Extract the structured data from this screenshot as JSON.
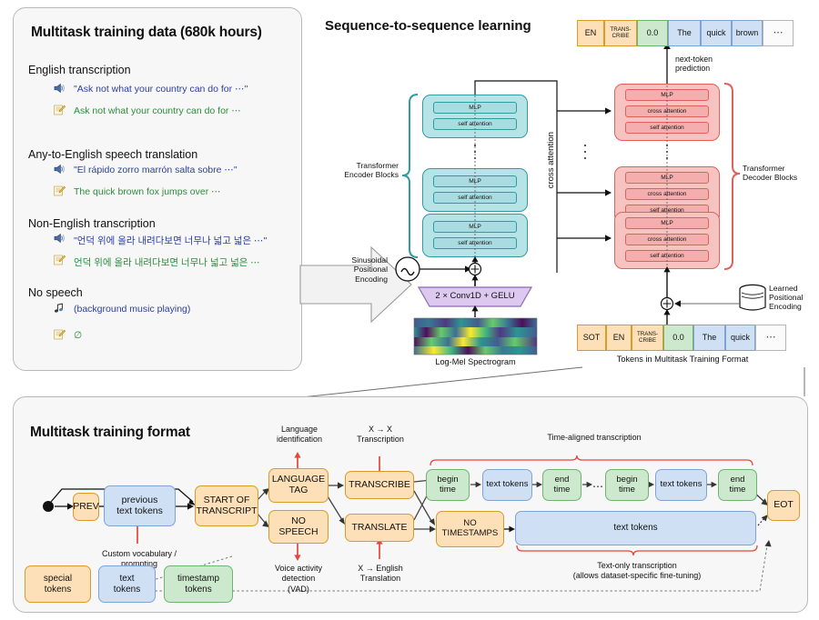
{
  "left_panel": {
    "title": "Multitask training data (680k hours)",
    "sections": [
      {
        "heading": "English transcription",
        "audio_icon": "speaker-icon",
        "audio": "\"Ask not what your country can do for ⋯\"",
        "text_icon": "note-pencil-icon",
        "text": "Ask not what your country can do for ⋯"
      },
      {
        "heading": "Any-to-English speech translation",
        "audio_icon": "speaker-icon",
        "audio": "\"El rápido zorro marrón salta sobre ⋯\"",
        "text_icon": "note-pencil-icon",
        "text": "The quick brown fox jumps over ⋯"
      },
      {
        "heading": "Non-English transcription",
        "audio_icon": "speaker-icon",
        "audio": "\"언덕 위에 올라 내려다보면 너무나 넓고 넓은 ⋯\"",
        "text_icon": "note-pencil-icon",
        "text": "언덕 위에 올라 내려다보면 너무나 넓고 넓은 ⋯"
      },
      {
        "heading": "No speech",
        "audio_icon": "music-note-icon",
        "audio": "(background music playing)",
        "text_icon": "note-pencil-icon",
        "text": "∅"
      }
    ]
  },
  "seq2seq": {
    "title": "Sequence-to-sequence learning",
    "encoder_label": "Transformer\nEncoder Blocks",
    "encoder_label_line1": "Transformer",
    "encoder_label_line2": "Encoder Blocks",
    "decoder_label_line1": "Transformer",
    "decoder_label_line2": "Decoder Blocks",
    "cross_attention_label": "cross attention",
    "sinusoidal_label_line1": "Sinusoidal",
    "sinusoidal_label_line2": "Positional",
    "sinusoidal_label_line3": "Encoding",
    "sinusoidal_icon": "sine-wave-icon",
    "learned_label_line1": "Learned",
    "learned_label_line2": "Positional",
    "learned_label_line3": "Encoding",
    "learned_icon": "database-cylinder-icon",
    "conv_label": "2 × Conv1D + GELU",
    "spectrogram_caption": "Log-Mel Spectrogram",
    "spectrogram_icon": "spectrogram-image",
    "next_token_line1": "next-token",
    "next_token_line2": "prediction",
    "tokens_caption": "Tokens in Multitask Training Format",
    "encoder_blocks": [
      {
        "mlp": "MLP",
        "self_attention": "self attention"
      },
      {
        "mlp": "MLP",
        "self_attention": "self attention"
      },
      {
        "mlp": "MLP",
        "self_attention": "self attention"
      }
    ],
    "decoder_blocks": [
      {
        "mlp": "MLP",
        "cross_attention": "cross attention",
        "self_attention": "self attention"
      },
      {
        "mlp": "MLP",
        "cross_attention": "cross attention",
        "self_attention": "self attention"
      },
      {
        "mlp": "MLP",
        "cross_attention": "cross attention",
        "self_attention": "self attention"
      }
    ],
    "output_tokens": [
      {
        "label": "EN",
        "kind": "special"
      },
      {
        "label": "TRANS-\nCRIBE",
        "l1": "TRANS-",
        "l2": "CRIBE",
        "kind": "special"
      },
      {
        "label": "0.0",
        "kind": "timestamp"
      },
      {
        "label": "The",
        "kind": "text"
      },
      {
        "label": "quick",
        "kind": "text"
      },
      {
        "label": "brown",
        "kind": "text"
      },
      {
        "label": "⋯",
        "kind": "blank"
      }
    ],
    "input_tokens": [
      {
        "label": "SOT",
        "kind": "special"
      },
      {
        "label": "EN",
        "kind": "special"
      },
      {
        "label": "TRANS-\nCRIBE",
        "l1": "TRANS-",
        "l2": "CRIBE",
        "kind": "special"
      },
      {
        "label": "0.0",
        "kind": "timestamp"
      },
      {
        "label": "The",
        "kind": "text"
      },
      {
        "label": "quick",
        "kind": "text"
      },
      {
        "label": "⋯",
        "kind": "blank"
      }
    ]
  },
  "format_panel": {
    "title": "Multitask training format",
    "boxes": {
      "prev": "PREV",
      "previous_text_tokens_l1": "previous",
      "previous_text_tokens_l2": "text tokens",
      "start_of_transcript_l1": "START OF",
      "start_of_transcript_l2": "TRANSCRIPT",
      "language_tag_l1": "LANGUAGE",
      "language_tag_l2": "TAG",
      "no_speech_l1": "NO",
      "no_speech_l2": "SPEECH",
      "transcribe": "TRANSCRIBE",
      "translate": "TRANSLATE",
      "no_timestamps_l1": "NO",
      "no_timestamps_l2": "TIMESTAMPS",
      "begin_time_l1": "begin",
      "begin_time_l2": "time",
      "end_time_l1": "end",
      "end_time_l2": "time",
      "text_tokens": "text tokens",
      "ellipsis": "⋯",
      "eot": "EOT"
    },
    "annotations": {
      "language_identification_l1": "Language",
      "language_identification_l2": "identification",
      "x_to_x_l1": "X → X",
      "x_to_x_l2": "Transcription",
      "time_aligned": "Time-aligned transcription",
      "custom_vocab_l1": "Custom vocabulary /",
      "custom_vocab_l2": "prompting",
      "vad_l1": "Voice activity",
      "vad_l2": "detection",
      "vad_l3": "(VAD)",
      "x_to_en_l1": "X → English",
      "x_to_en_l2": "Translation",
      "text_only_l1": "Text-only transcription",
      "text_only_l2": "(allows dataset-specific fine-tuning)"
    },
    "legend": [
      {
        "l1": "special",
        "l2": "tokens",
        "kind": "special"
      },
      {
        "l1": "text",
        "l2": "tokens",
        "kind": "text"
      },
      {
        "l1": "timestamp",
        "l2": "tokens",
        "kind": "timestamp"
      }
    ]
  },
  "colors": {
    "special": "#fde0b8",
    "special_border": "#d99b2b",
    "text": "#cfe0f5",
    "text_border": "#7fa4d4",
    "timestamp": "#cde9cd",
    "timestamp_border": "#6fb36f",
    "encoder": "#b6e4e6",
    "encoder_border": "#2f9ba3",
    "decoder": "#f7c3c0",
    "decoder_border": "#e0605c",
    "conv": "#ddc9ef",
    "conv_border": "#8b6bb3",
    "annotation_red": "#e8443a",
    "audio_text": "#2b3fa0",
    "transcript_text": "#2e8b3d"
  }
}
